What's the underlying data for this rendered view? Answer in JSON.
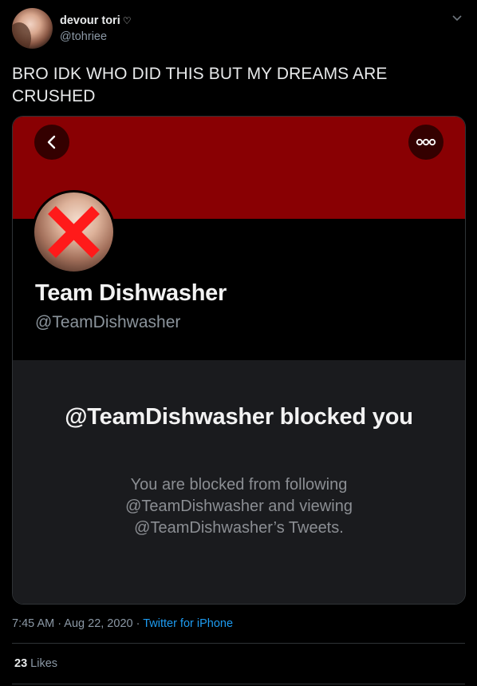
{
  "tweet": {
    "author_name": "devour tori",
    "author_heart": "♡",
    "author_handle": "@tohriee",
    "text": "BRO IDK WHO DID THIS BUT MY DREAMS ARE CRUSHED",
    "time": "7:45 AM",
    "date": "Aug 22, 2020",
    "source": "Twitter for iPhone",
    "likes_count": "23",
    "likes_label": "Likes"
  },
  "screenshot": {
    "display_name": "Team Dishwasher",
    "handle": "@TeamDishwasher",
    "blocked_title": "@TeamDishwasher blocked you",
    "blocked_description": "You are blocked from following @TeamDishwasher and viewing @TeamDishwasher’s Tweets.",
    "banner_color": "#890003"
  },
  "icons": {
    "caret": "chevron-down-icon",
    "back": "back-arrow-icon",
    "more": "more-options-icon",
    "cross": "red-x-icon"
  }
}
